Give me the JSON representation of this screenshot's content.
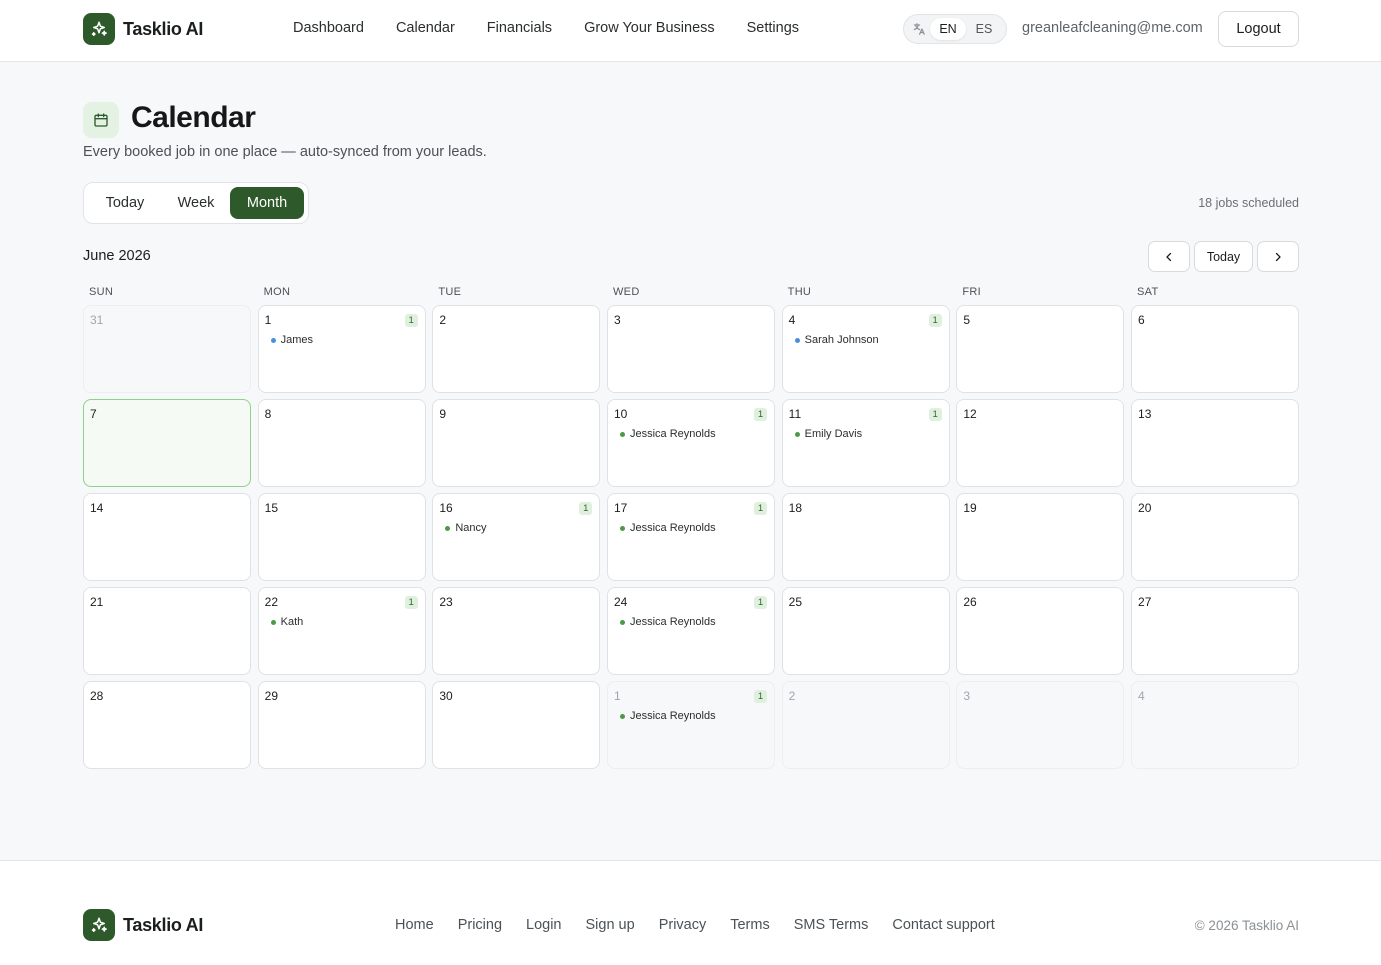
{
  "brand": {
    "name": "Tasklio AI"
  },
  "nav": [
    "Dashboard",
    "Calendar",
    "Financials",
    "Grow Your Business",
    "Settings"
  ],
  "language": {
    "options": [
      "EN",
      "ES"
    ],
    "selected": "EN"
  },
  "user": {
    "email": "greanleafcleaning@me.com",
    "logout_label": "Logout"
  },
  "page": {
    "title": "Calendar",
    "subtitle": "Every booked job in one place — auto-synced from your leads."
  },
  "view_toggle": {
    "today": "Today",
    "week": "Week",
    "month": "Month",
    "active": "Month"
  },
  "jobs_count": "18 jobs scheduled",
  "calendar": {
    "month_label": "June 2026",
    "today_label": "Today",
    "weekdays": [
      "SUN",
      "MON",
      "TUE",
      "WED",
      "THU",
      "FRI",
      "SAT"
    ],
    "colors": {
      "blue": "#4a90d9",
      "green": "#4c9a47"
    },
    "days": [
      {
        "num": "31",
        "outside": true
      },
      {
        "num": "1",
        "count": "1",
        "events": [
          {
            "name": "James",
            "color": "#4a90d9"
          }
        ]
      },
      {
        "num": "2"
      },
      {
        "num": "3"
      },
      {
        "num": "4",
        "count": "1",
        "events": [
          {
            "name": "Sarah Johnson",
            "color": "#4a90d9"
          }
        ]
      },
      {
        "num": "5"
      },
      {
        "num": "6"
      },
      {
        "num": "7",
        "today": true
      },
      {
        "num": "8"
      },
      {
        "num": "9"
      },
      {
        "num": "10",
        "count": "1",
        "events": [
          {
            "name": "Jessica Reynolds",
            "color": "#4c9a47"
          }
        ]
      },
      {
        "num": "11",
        "count": "1",
        "events": [
          {
            "name": "Emily Davis",
            "color": "#4c9a47"
          }
        ]
      },
      {
        "num": "12"
      },
      {
        "num": "13"
      },
      {
        "num": "14"
      },
      {
        "num": "15"
      },
      {
        "num": "16",
        "count": "1",
        "events": [
          {
            "name": "Nancy",
            "color": "#4c9a47"
          }
        ]
      },
      {
        "num": "17",
        "count": "1",
        "events": [
          {
            "name": "Jessica Reynolds",
            "color": "#4c9a47"
          }
        ]
      },
      {
        "num": "18"
      },
      {
        "num": "19"
      },
      {
        "num": "20"
      },
      {
        "num": "21"
      },
      {
        "num": "22",
        "count": "1",
        "events": [
          {
            "name": "Kath",
            "color": "#4c9a47"
          }
        ]
      },
      {
        "num": "23"
      },
      {
        "num": "24",
        "count": "1",
        "events": [
          {
            "name": "Jessica Reynolds",
            "color": "#4c9a47"
          }
        ]
      },
      {
        "num": "25"
      },
      {
        "num": "26"
      },
      {
        "num": "27"
      },
      {
        "num": "28"
      },
      {
        "num": "29"
      },
      {
        "num": "30"
      },
      {
        "num": "1",
        "outside": true,
        "count": "1",
        "events": [
          {
            "name": "Jessica Reynolds",
            "color": "#4c9a47"
          }
        ]
      },
      {
        "num": "2",
        "outside": true
      },
      {
        "num": "3",
        "outside": true
      },
      {
        "num": "4",
        "outside": true
      }
    ]
  },
  "footer": {
    "links": [
      "Home",
      "Pricing",
      "Login",
      "Sign up",
      "Privacy",
      "Terms",
      "SMS Terms",
      "Contact support"
    ],
    "copyright": "© 2026 Tasklio AI"
  }
}
